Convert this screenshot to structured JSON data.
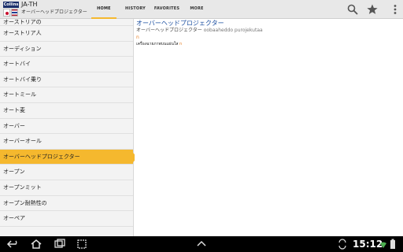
{
  "app": {
    "logo_text": "Collins",
    "title": "JA-TH",
    "subtitle": "オーバーヘッドプロジェクター"
  },
  "tabs": [
    {
      "label": "HOME",
      "active": true
    },
    {
      "label": "HISTORY",
      "active": false
    },
    {
      "label": "FAVORITES",
      "active": false
    },
    {
      "label": "MORE",
      "active": false
    }
  ],
  "actions": [
    "search-icon",
    "star-icon",
    "overflow-menu-icon"
  ],
  "colors": {
    "accent": "#f5b82e",
    "headword": "#1b4fa0",
    "pos": "#e67e22",
    "list_bg": "#f3f3f3",
    "system_bar": "#000000"
  },
  "word_list": [
    "オーストリアの",
    "オーストリア人",
    "オーディション",
    "オートバイ",
    "オートバイ乗り",
    "オートミール",
    "オート麦",
    "オーバー",
    "オーバーオール",
    "オーバーヘッドプロジェクター",
    "オープン",
    "オープンミット",
    "オープン耐熱性の",
    "オーペア"
  ],
  "selected_index": 9,
  "entry": {
    "headword": "オーバーヘッドプロジェクター",
    "reading": "オーバーヘッドプロジェクター",
    "romaji": "oobaaheddo purojekutaa",
    "pos": "n",
    "translation": "เครื่องฉายภาพบนแผ่นใส",
    "translation_pos": "n"
  },
  "system": {
    "clock": "15:12"
  }
}
